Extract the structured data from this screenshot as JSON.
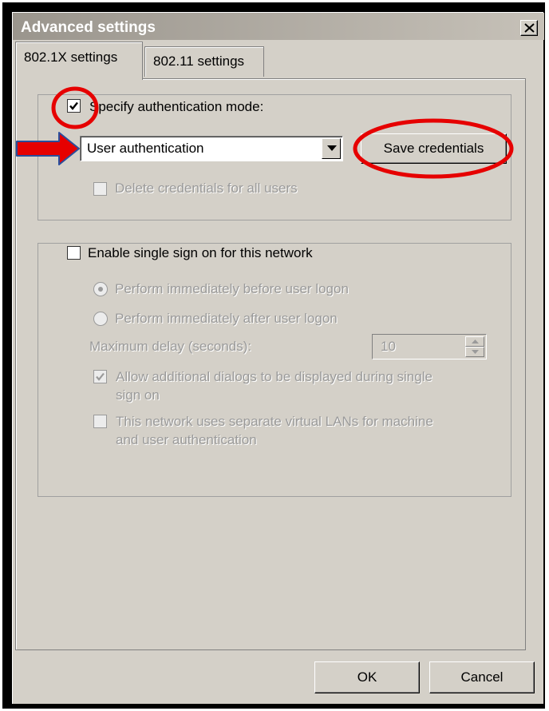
{
  "window": {
    "title": "Advanced settings",
    "close_icon": "close-icon"
  },
  "tabs": [
    {
      "label": "802.1X settings",
      "active": true
    },
    {
      "label": "802.11 settings",
      "active": false
    }
  ],
  "auth_group": {
    "specify_mode_label": "Specify authentication mode:",
    "specify_mode_checked": true,
    "mode_select_value": "User authentication",
    "save_credentials_label": "Save credentials",
    "delete_credentials_label": "Delete credentials for all users",
    "delete_credentials_checked": false
  },
  "sso_group": {
    "enable_label": "Enable single sign on for this network",
    "enable_checked": false,
    "radio_before_label": "Perform immediately before user logon",
    "radio_before_selected": true,
    "radio_after_label": "Perform immediately after user logon",
    "max_delay_label": "Maximum delay (seconds):",
    "max_delay_value": "10",
    "allow_dialogs_label_line1": "Allow additional dialogs to be displayed during single",
    "allow_dialogs_label_line2": "sign on",
    "allow_dialogs_checked": true,
    "separate_vlans_label_line1": "This network uses separate virtual LANs for machine",
    "separate_vlans_label_line2": "and user authentication",
    "separate_vlans_checked": false
  },
  "footer": {
    "ok_label": "OK",
    "cancel_label": "Cancel"
  },
  "colors": {
    "dialog_bg": "#d4d0c8",
    "annotation_red": "#e60000",
    "annotation_arrow_outline": "#2a4d9b",
    "disabled_text": "#9a9a9a"
  }
}
